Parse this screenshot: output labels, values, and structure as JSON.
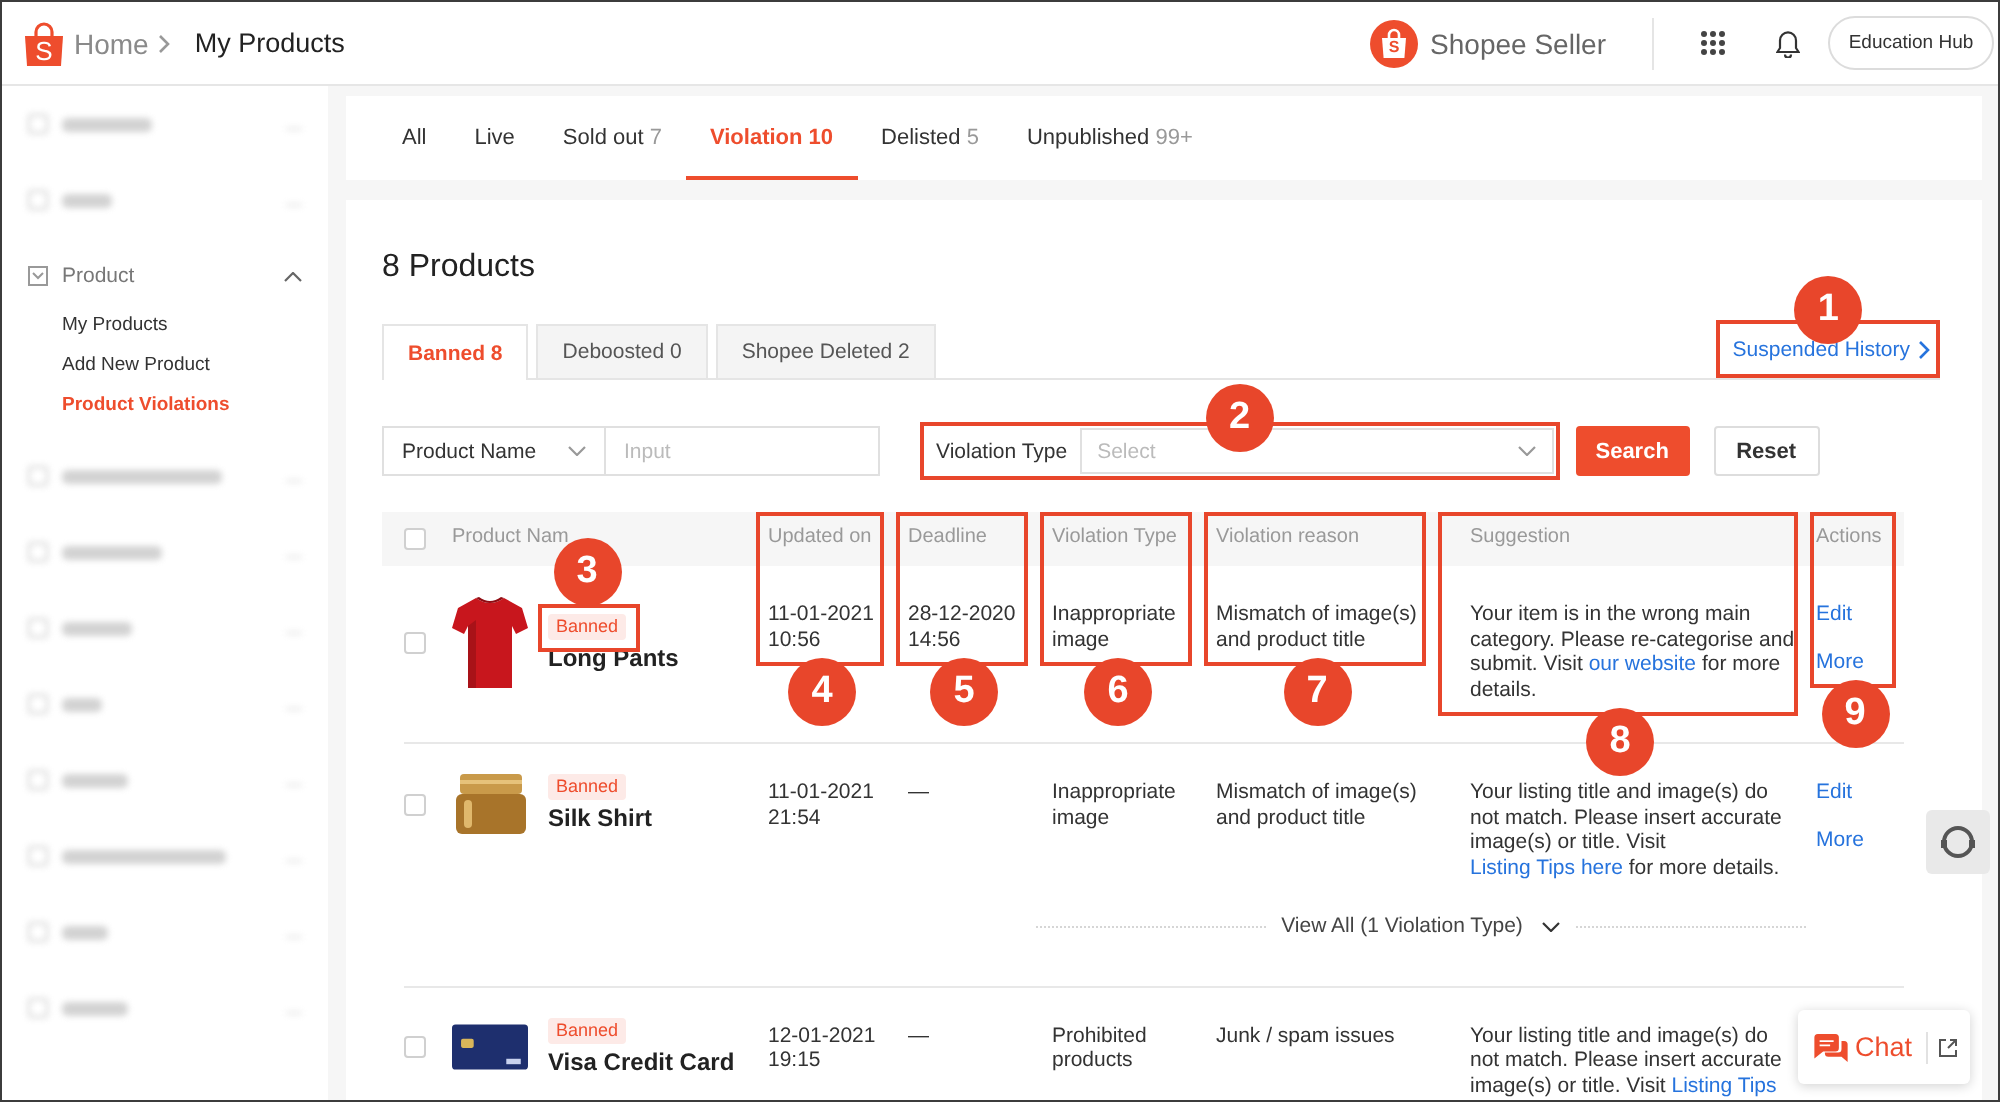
{
  "topbar": {
    "logo_letter": "S",
    "breadcrumb": [
      "Home",
      "My Products"
    ],
    "brand": {
      "logo_letter": "S",
      "name": "Shopee Seller"
    },
    "education_button": "Education Hub"
  },
  "sidebar": {
    "items": [
      {
        "kind": "blurred"
      },
      {
        "kind": "blurred"
      },
      {
        "kind": "group",
        "label": "Product",
        "expanded": true,
        "children": [
          {
            "label": "My Products",
            "selected": false
          },
          {
            "label": "Add New Product",
            "selected": false
          },
          {
            "label": "Product Violations",
            "selected": true
          }
        ]
      },
      {
        "kind": "blurred"
      },
      {
        "kind": "blurred"
      },
      {
        "kind": "blurred"
      },
      {
        "kind": "blurred"
      },
      {
        "kind": "blurred"
      },
      {
        "kind": "blurred"
      },
      {
        "kind": "blurred"
      },
      {
        "kind": "blurred"
      }
    ]
  },
  "status_tabs": [
    {
      "label": "All",
      "selected": false
    },
    {
      "label": "Live",
      "selected": false
    },
    {
      "label": "Sold out",
      "count": "7",
      "selected": false
    },
    {
      "label": "Violation",
      "count": "10",
      "selected": true
    },
    {
      "label": "Delisted",
      "count": "5",
      "selected": false
    },
    {
      "label": "Unpublished",
      "count": "99+",
      "selected": false
    }
  ],
  "panel": {
    "heading": "8 Products",
    "violation_tabs": [
      {
        "label": "Banned 8",
        "selected": true
      },
      {
        "label": "Deboosted 0",
        "selected": false
      },
      {
        "label": "Shopee Deleted 2",
        "selected": false
      }
    ],
    "suspended_history": {
      "label": "Suspended History",
      "callout": "1"
    },
    "filters": {
      "field_select": "Product Name",
      "input_placeholder": "Input",
      "violation_type": {
        "label": "Violation Type",
        "placeholder": "Select",
        "callout": "2"
      },
      "search_button": "Search",
      "reset_button": "Reset"
    },
    "table": {
      "select_all_checked": false,
      "columns": [
        {
          "label": "Product Nam"
        },
        {
          "label": "Updated on",
          "callout": "4"
        },
        {
          "label": "Deadline",
          "callout": "5"
        },
        {
          "label": "Violation Type",
          "callout": "6"
        },
        {
          "label": "Violation reason",
          "callout": "7"
        },
        {
          "label": "Suggestion",
          "callout": "8"
        },
        {
          "label": "Actions",
          "callout": "9"
        }
      ],
      "rows": [
        {
          "kind": "t-shirt",
          "checked": false,
          "badge": {
            "label": "Banned",
            "callout": "3"
          },
          "name": "Long Pants",
          "updated_on": "11-01-2021 10:56",
          "deadline": "28-12-2020 14:56",
          "violation_type": "Inappropriate image",
          "violation_reason": "Mismatch of image(s) and product title",
          "suggestion": {
            "text": "Your item is in the wrong main category. Please re-categorise and submit. Visit ",
            "link": "our website",
            "text_after": " for more details."
          },
          "actions": [
            "Edit",
            "More"
          ]
        },
        {
          "kind": "jar",
          "checked": false,
          "badge": {
            "label": "Banned"
          },
          "name": "Silk Shirt",
          "updated_on": "11-01-2021 21:54",
          "deadline": "—",
          "violation_type": "Inappropriate image",
          "violation_reason": "Mismatch of image(s) and product title",
          "suggestion": {
            "text": "Your listing title and image(s) do not match. Please insert accurate image(s) or title. Visit ",
            "link": "Listing Tips here",
            "text_after": " for more details."
          },
          "actions": [
            "Edit",
            "More"
          ],
          "view_all": "View All (1 Violation Type)"
        },
        {
          "kind": "card",
          "checked": false,
          "badge": {
            "label": "Banned"
          },
          "name": "Visa Credit Card",
          "updated_on": "12-01-2021 19:15",
          "deadline": "—",
          "violation_type": "Prohibited products",
          "violation_reason": "Junk / spam issues",
          "suggestion": {
            "text": "Your listing title and image(s) do not match. Please insert accurate image(s) or title. Visit ",
            "link": "Listing Tips"
          }
        }
      ]
    }
  },
  "chat": {
    "label": "Chat"
  }
}
